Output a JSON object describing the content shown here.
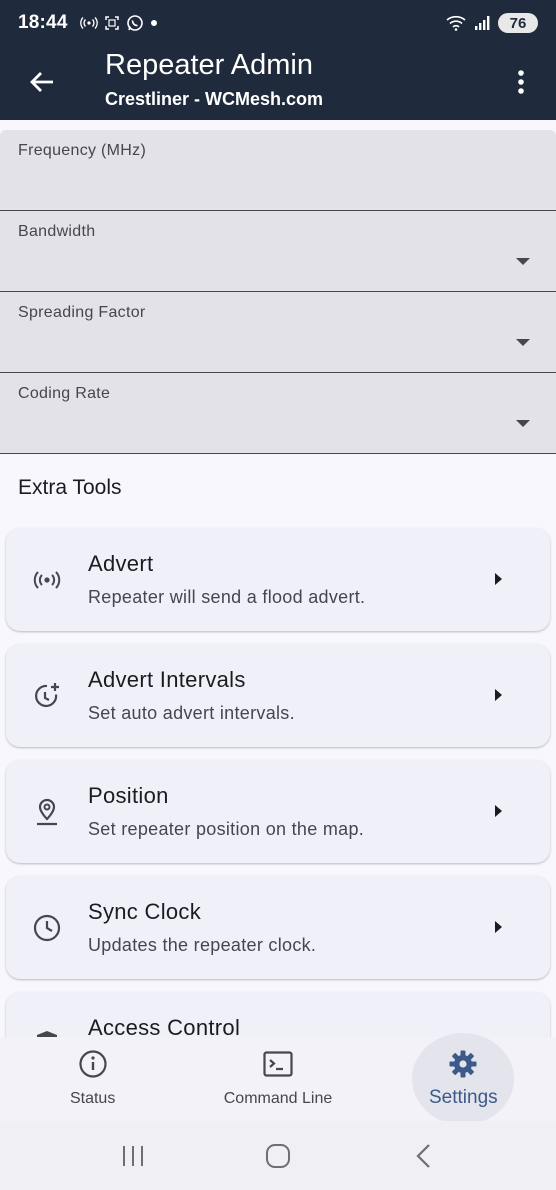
{
  "status_bar": {
    "time": "18:44",
    "battery": "76"
  },
  "app_bar": {
    "title": "Repeater Admin",
    "subtitle": "Crestliner - WCMesh.com"
  },
  "fields": [
    {
      "label": "Frequency (MHz)",
      "value": "",
      "has_dropdown": false
    },
    {
      "label": "Bandwidth",
      "value": "",
      "has_dropdown": true
    },
    {
      "label": "Spreading Factor",
      "value": "",
      "has_dropdown": true
    },
    {
      "label": "Coding Rate",
      "value": "",
      "has_dropdown": true
    }
  ],
  "extra_tools": {
    "title": "Extra Tools",
    "items": [
      {
        "title": "Advert",
        "subtitle": "Repeater will send a flood advert.",
        "icon": "broadcast-icon"
      },
      {
        "title": "Advert Intervals",
        "subtitle": "Set auto advert intervals.",
        "icon": "clock-add-icon"
      },
      {
        "title": "Position",
        "subtitle": "Set repeater position on the map.",
        "icon": "location-pin-icon"
      },
      {
        "title": "Sync Clock",
        "subtitle": "Updates the repeater clock.",
        "icon": "clock-icon"
      },
      {
        "title": "Access Control",
        "subtitle": "",
        "icon": "shield-icon"
      }
    ]
  },
  "bottom_nav": {
    "items": [
      {
        "label": "Status",
        "icon": "info-icon",
        "active": false
      },
      {
        "label": "Command Line",
        "icon": "terminal-icon",
        "active": false
      },
      {
        "label": "Settings",
        "icon": "gear-icon",
        "active": true
      }
    ]
  },
  "colors": {
    "app_bar_bg": "#1f2a3c",
    "field_bg": "#e2e2e8",
    "card_bg": "#f0f0f9",
    "active_nav": "#3b5a8a"
  }
}
